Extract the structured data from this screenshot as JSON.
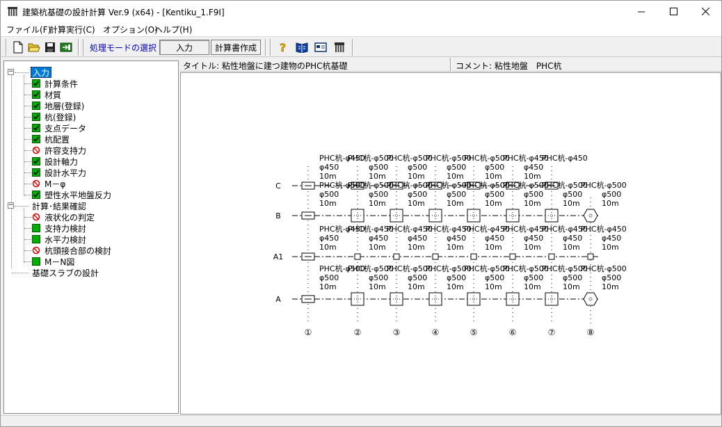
{
  "window": {
    "title": "建築杭基礎の設計計算 Ver.9 (x64) - [Kentiku_1.F9I]",
    "controls": {
      "minimize": "—",
      "maximize": "☐",
      "close": "✕"
    }
  },
  "menubar": {
    "items": [
      "ファイル(F)",
      "計算実行(C)",
      "オプション(O)",
      "ヘルプ(H)"
    ]
  },
  "toolbar": {
    "icons": [
      "new-file-icon",
      "open-folder-icon",
      "save-icon",
      "export-icon",
      "help-icon",
      "manual-icon",
      "card-icon",
      "building-icon"
    ],
    "mode_label": "処理モードの選択",
    "mode_value": "入力",
    "report_button": "計算書作成"
  },
  "info": {
    "title": "タイトル: 粘性地盤に建つ建物のPHC杭基礎",
    "comment": "コメント: 粘性地盤　PHC杭"
  },
  "tree": {
    "input_root": "入力",
    "input_items": [
      {
        "label": "計算条件",
        "status": "checked"
      },
      {
        "label": "材質",
        "status": "checked"
      },
      {
        "label": "地層(登録)",
        "status": "checked"
      },
      {
        "label": "杭(登録)",
        "status": "checked"
      },
      {
        "label": "支点データ",
        "status": "checked"
      },
      {
        "label": "杭配置",
        "status": "checked"
      },
      {
        "label": "許容支持力",
        "status": "prohibited"
      },
      {
        "label": "設計軸力",
        "status": "checked"
      },
      {
        "label": "設計水平力",
        "status": "checked"
      },
      {
        "label": "M－φ",
        "status": "prohibited"
      },
      {
        "label": "塑性水平地盤反力",
        "status": "checked"
      }
    ],
    "calc_root": "計算･結果確認",
    "calc_items": [
      {
        "label": "液状化の判定",
        "status": "prohibited"
      },
      {
        "label": "支持力検討",
        "status": "ok"
      },
      {
        "label": "水平力検討",
        "status": "ok"
      },
      {
        "label": "杭頭接合部の検討",
        "status": "prohibited"
      },
      {
        "label": "M－N図",
        "status": "ok"
      }
    ],
    "slab_item": "基礎スラブの設計",
    "colors": {
      "check_green": "#00b000",
      "prohibited_red": "#e00000",
      "selected_bg": "#0078d7"
    }
  },
  "pile_plan": {
    "columns": [
      "①",
      "②",
      "③",
      "④",
      "⑤",
      "⑥",
      "⑦",
      "⑧"
    ],
    "rows": [
      {
        "label": "C",
        "columns": 7,
        "piles": [
          {
            "line1": "PHC杭-φ450",
            "line2": "φ450",
            "line3": "10m"
          },
          {
            "line1": "PHC杭-φ500",
            "line2": "φ500",
            "line3": "10m"
          },
          {
            "line1": "PHC杭-φ500",
            "line2": "φ500",
            "line3": "10m"
          },
          {
            "line1": "PHC杭-φ500",
            "line2": "φ500",
            "line3": "10m"
          },
          {
            "line1": "PHC杭-φ500",
            "line2": "φ500",
            "line3": "10m"
          },
          {
            "line1": "PHC杭-φ450",
            "line2": "φ450",
            "line3": "10m"
          },
          {
            "line1": "PHC杭-φ450",
            "line2": "",
            "line3": ""
          }
        ]
      },
      {
        "label": "B",
        "columns": 8,
        "piles": [
          {
            "line1": "PHC杭-φ500",
            "line2": "φ500",
            "line3": "10m"
          },
          {
            "line1": "PHC杭-φ500",
            "line2": "φ500",
            "line3": "10m"
          },
          {
            "line1": "PHC杭-φ500",
            "line2": "φ500",
            "line3": "10m"
          },
          {
            "line1": "PHC杭-φ500",
            "line2": "φ500",
            "line3": "10m"
          },
          {
            "line1": "PHC杭-φ500",
            "line2": "φ500",
            "line3": "10m"
          },
          {
            "line1": "PHC杭-φ500",
            "line2": "φ500",
            "line3": "10m"
          },
          {
            "line1": "PHC杭-φ500",
            "line2": "φ500",
            "line3": "10m"
          },
          {
            "line1": "PHC杭-φ500",
            "line2": "φ500",
            "line3": "10m"
          }
        ]
      },
      {
        "label": "A1",
        "columns": 8,
        "piles": [
          {
            "line1": "PHC杭-φ450",
            "line2": "φ450",
            "line3": "10m"
          },
          {
            "line1": "PHC杭-φ450",
            "line2": "φ450",
            "line3": "10m"
          },
          {
            "line1": "PHC杭-φ450",
            "line2": "φ450",
            "line3": "10m"
          },
          {
            "line1": "PHC杭-φ450",
            "line2": "φ450",
            "line3": "10m"
          },
          {
            "line1": "PHC杭-φ450",
            "line2": "φ450",
            "line3": "10m"
          },
          {
            "line1": "PHC杭-φ450",
            "line2": "φ450",
            "line3": "10m"
          },
          {
            "line1": "PHC杭-φ450",
            "line2": "φ450",
            "line3": "10m"
          },
          {
            "line1": "PHC杭-φ450",
            "line2": "φ450",
            "line3": "10m"
          }
        ]
      },
      {
        "label": "A",
        "columns": 8,
        "piles": [
          {
            "line1": "PHC杭-φ500",
            "line2": "φ500",
            "line3": "10m"
          },
          {
            "line1": "PHC杭-φ500",
            "line2": "φ500",
            "line3": "10m"
          },
          {
            "line1": "PHC杭-φ500",
            "line2": "φ500",
            "line3": "10m"
          },
          {
            "line1": "PHC杭-φ500",
            "line2": "φ500",
            "line3": "10m"
          },
          {
            "line1": "PHC杭-φ500",
            "line2": "φ500",
            "line3": "10m"
          },
          {
            "line1": "PHC杭-φ500",
            "line2": "φ500",
            "line3": "10m"
          },
          {
            "line1": "PHC杭-φ500",
            "line2": "φ500",
            "line3": "10m"
          },
          {
            "line1": "PHC杭-φ500",
            "line2": "φ500",
            "line3": "10m"
          }
        ]
      }
    ]
  }
}
